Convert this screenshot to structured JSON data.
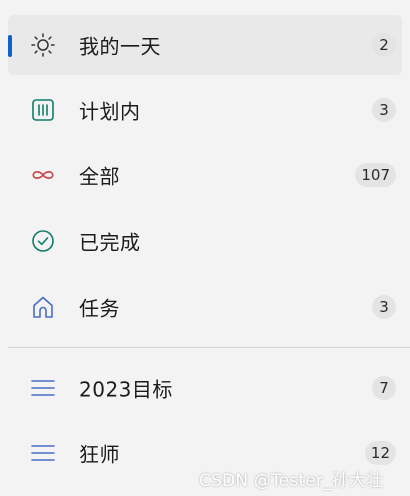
{
  "colors": {
    "selection_indicator": "#0f62c8",
    "sun_icon": "#333333",
    "planned_icon": "#107c6a",
    "all_icon": "#c84a4a",
    "completed_icon": "#107c6a",
    "tasks_icon": "#4a6cc7",
    "list_icon": "#4a6cc7"
  },
  "nav": {
    "smart_lists": [
      {
        "label": "我的一天",
        "count": "2",
        "icon": "sun-icon",
        "selected": true
      },
      {
        "label": "计划内",
        "count": "3",
        "icon": "calendar-grid-icon",
        "selected": false
      },
      {
        "label": "全部",
        "count": "107",
        "icon": "infinity-icon",
        "selected": false
      },
      {
        "label": "已完成",
        "count": "",
        "icon": "check-circle-icon",
        "selected": false
      },
      {
        "label": "任务",
        "count": "3",
        "icon": "home-icon",
        "selected": false
      }
    ],
    "user_lists": [
      {
        "label": "2023目标",
        "count": "7",
        "icon": "list-icon"
      },
      {
        "label": "狂师",
        "count": "12",
        "icon": "list-icon"
      }
    ]
  },
  "watermark": "CSDN @Tester_孙大壮"
}
